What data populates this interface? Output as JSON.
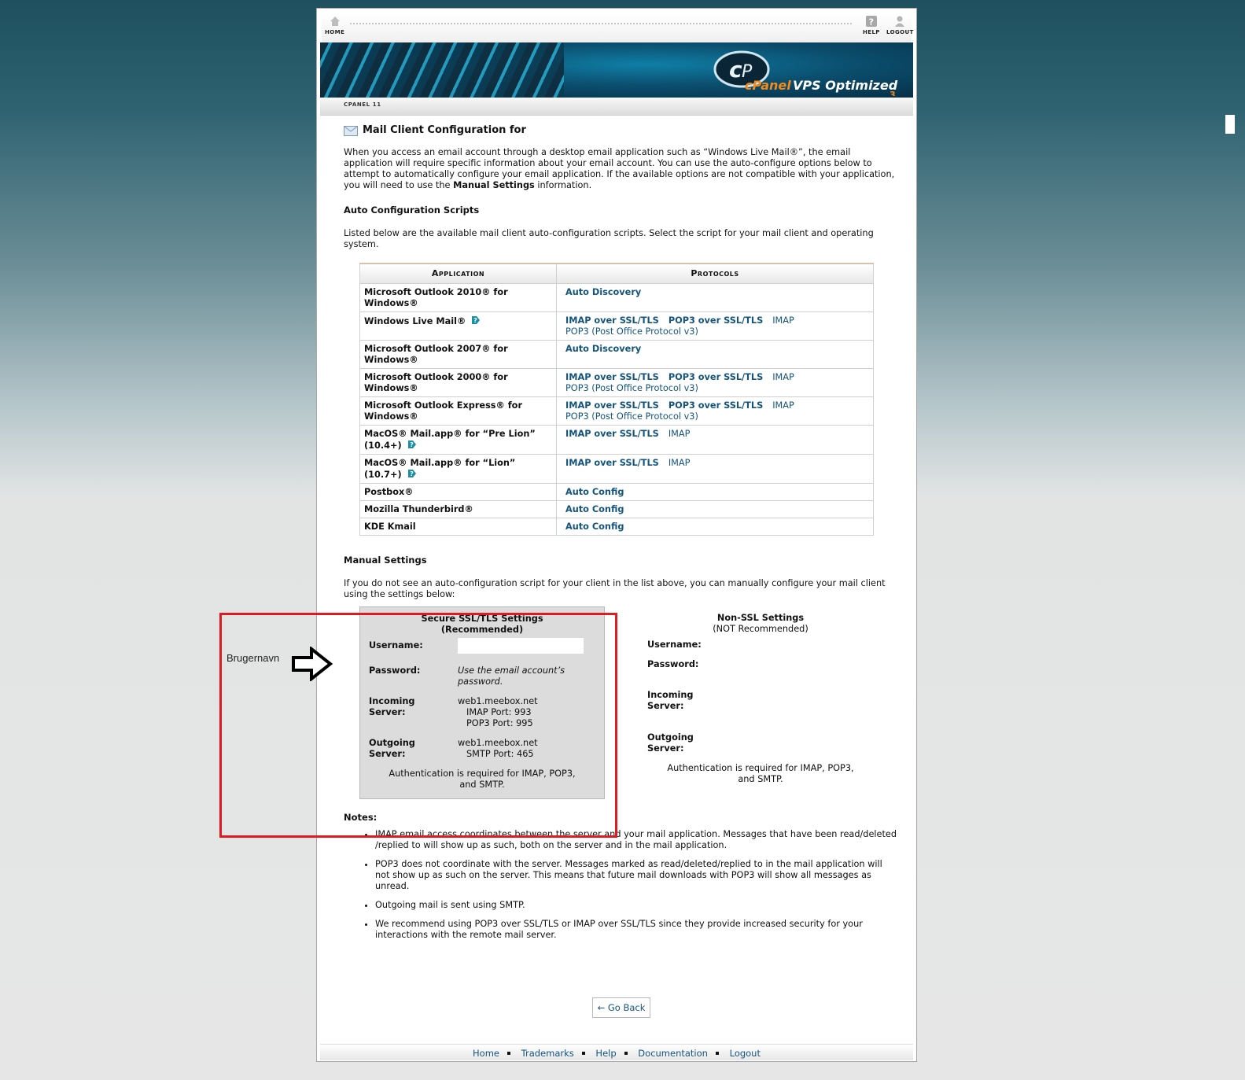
{
  "topbar": {
    "home": "HOME",
    "help": "HELP",
    "logout": "LOGOUT"
  },
  "banner": {
    "brand": "cPanel",
    "product": "VPS Optimized",
    "version_sub": "3"
  },
  "version_bar": "CPANEL 11",
  "page": {
    "title": "Mail Client Configuration for",
    "intro_1": "When you access an email account through a desktop email application such as “Windows Live Mail®”, the email application will require specific information about your email account. You can use the auto-configure options below to attempt to automatically configure your email application. If the available options are not compatible with your application, you will need to use the ",
    "intro_bold": "Manual Settings",
    "intro_2": " information.",
    "auto_heading": "Auto Configuration Scripts",
    "auto_desc": "Listed below are the available mail client auto-configuration scripts. Select the script for your mail client and operating system."
  },
  "table": {
    "headers": [
      "Application",
      "Protocols"
    ],
    "rows": [
      {
        "app": "Microsoft Outlook 2010® for Windows®",
        "l1": "Auto Discovery",
        "l2": "",
        "l3": "",
        "l4": ""
      },
      {
        "app": "Windows Live Mail®",
        "l1": "IMAP over SSL/TLS",
        "l2": "POP3 over SSL/TLS",
        "l3": "IMAP",
        "l4": "POP3 (Post Office Protocol v3)"
      },
      {
        "app": "Microsoft Outlook 2007® for Windows®",
        "l1": "Auto Discovery",
        "l2": "",
        "l3": "",
        "l4": ""
      },
      {
        "app": "Microsoft Outlook 2000® for Windows®",
        "l1": "IMAP over SSL/TLS",
        "l2": "POP3 over SSL/TLS",
        "l3": "IMAP",
        "l4": "POP3 (Post Office Protocol v3)"
      },
      {
        "app": "Microsoft Outlook Express® for Windows®",
        "l1": "IMAP over SSL/TLS",
        "l2": "POP3 over SSL/TLS",
        "l3": "IMAP",
        "l4": "POP3 (Post Office Protocol v3)"
      },
      {
        "app": "MacOS® Mail.app® for “Pre Lion” (10.4+)",
        "l1": "IMAP over SSL/TLS",
        "l2": "",
        "l3": "IMAP",
        "l4": ""
      },
      {
        "app": "MacOS® Mail.app® for “Lion” (10.7+)",
        "l1": "IMAP over SSL/TLS",
        "l2": "",
        "l3": "IMAP",
        "l4": ""
      },
      {
        "app": "Postbox®",
        "l1": "Auto Config",
        "l2": "",
        "l3": "",
        "l4": ""
      },
      {
        "app": "Mozilla Thunderbird®",
        "l1": "Auto Config",
        "l2": "",
        "l3": "",
        "l4": ""
      },
      {
        "app": "KDE Kmail",
        "l1": "Auto Config",
        "l2": "",
        "l3": "",
        "l4": ""
      }
    ]
  },
  "manual": {
    "heading": "Manual Settings",
    "desc": "If you do not see an auto-configuration script for your client in the list above, you can manually configure your mail client using the settings below:",
    "labels": {
      "username": "Username:",
      "password": "Password:",
      "incoming_1": "Incoming",
      "incoming_2": "Server:",
      "outgoing_1": "Outgoing",
      "outgoing_2": "Server:"
    },
    "ssl": {
      "title": "Secure SSL/TLS Settings",
      "subtitle": "(Recommended)",
      "username": "",
      "password": "Use the email account’s password.",
      "incoming_server": "web1.meebox.net",
      "imap_port": "IMAP Port: 993",
      "pop3_port": "POP3 Port: 995",
      "outgoing_server": "web1.meebox.net",
      "smtp_port": "SMTP Port: 465",
      "auth": "Authentication is required for IMAP, POP3, and SMTP."
    },
    "nonssl": {
      "title": "Non-SSL Settings",
      "subtitle": "(NOT Recommended)",
      "auth": "Authentication is required for IMAP, POP3, and SMTP."
    }
  },
  "notes": {
    "heading": "Notes:",
    "items": [
      "IMAP email access coordinates between the server and your mail application. Messages that have been read/deleted /replied to will show up as such, both on the server and in the mail application.",
      "POP3 does not coordinate with the server. Messages marked as read/deleted/replied to in the mail application will not show up as such on the server. This means that future mail downloads with POP3 will show all messages as unread.",
      "Outgoing mail is sent using SMTP.",
      "We recommend using POP3 over SSL/TLS or IMAP over SSL/TLS since they provide increased security for your interactions with the remote mail server."
    ]
  },
  "go_back": "← Go Back",
  "footer": {
    "home": "Home",
    "trademarks": "Trademarks",
    "help": "Help",
    "documentation": "Documentation",
    "logout": "Logout"
  },
  "annotation": {
    "label": "Brugernavn",
    "highlight_color": "#e01a22"
  }
}
